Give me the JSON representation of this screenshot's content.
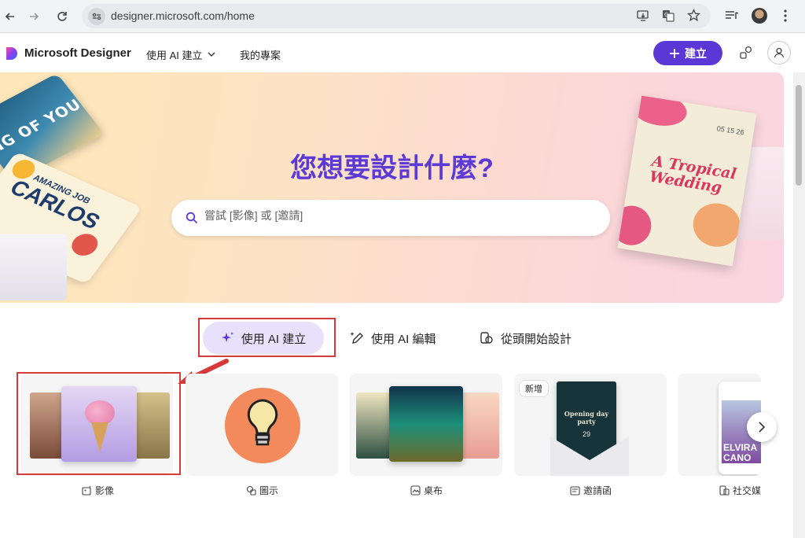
{
  "browser": {
    "url": "designer.microsoft.com/home"
  },
  "header": {
    "brand": "Microsoft Designer",
    "nav": [
      {
        "label": "使用 AI 建立"
      },
      {
        "label": "我的專案"
      }
    ],
    "create_label": "建立"
  },
  "hero": {
    "title": "您想要設計什麼?",
    "search_placeholder": "嘗試 [影像] 或 [邀請]",
    "deco_card1_text": "NG OF YOU",
    "deco_card2_small": "AMAZING JOB",
    "deco_card2_big": "CARLOS",
    "wedding_title": "A Tropical Wedding",
    "wedding_date": "05 15 26"
  },
  "tabs": [
    {
      "label": "使用 AI 建立",
      "active": true
    },
    {
      "label": "使用 AI 編輯",
      "active": false
    },
    {
      "label": "從頭開始設計",
      "active": false
    }
  ],
  "categories": [
    {
      "label": "影像"
    },
    {
      "label": "圖示"
    },
    {
      "label": "桌布"
    },
    {
      "label": "邀請函",
      "badge": "新增",
      "card_title": "Opening day party",
      "card_date": "29"
    },
    {
      "label": "社交媒",
      "card_title": "ELVIRA CANO"
    }
  ],
  "colors": {
    "accent": "#5b38d6",
    "highlight_red": "#d63a3a"
  }
}
